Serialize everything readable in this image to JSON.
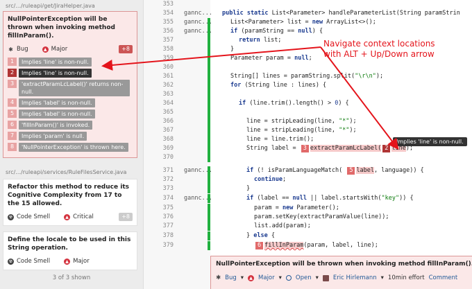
{
  "issues": [
    {
      "file": "src/.../ruleapi/get/JiraHelper.java",
      "title": "NullPointerException will be thrown when invoking method fillInParam().",
      "type": "Bug",
      "severity": "Major",
      "count": "+8",
      "locations": [
        {
          "n": "1",
          "text": "Implies 'line' is non-null."
        },
        {
          "n": "2",
          "text": "Implies 'line' is non-null."
        },
        {
          "n": "3",
          "text": "'extractParamLcLabel()' returns non-null."
        },
        {
          "n": "4",
          "text": "Implies 'label' is non-null."
        },
        {
          "n": "5",
          "text": "Implies 'label' is non-null."
        },
        {
          "n": "6",
          "text": "'fillInParam()' is invoked."
        },
        {
          "n": "7",
          "text": "Implies 'param' is null."
        },
        {
          "n": "8",
          "text": "'NullPointerException' is thrown here."
        }
      ]
    },
    {
      "file": "src/.../ruleapi/services/RuleFilesService.java",
      "title": "Refactor this method to reduce its Cognitive Complexity from 17 to the 15 allowed.",
      "type": "Code Smell",
      "severity": "Critical",
      "count": "+8"
    },
    {
      "title": "Define the locale to be used in this String operation.",
      "type": "Code Smell",
      "severity": "Major"
    }
  ],
  "shown_label": "3 of 3 shown",
  "code": {
    "lines": [
      {
        "ln": "353",
        "author": ""
      },
      {
        "ln": "354",
        "author": "gannc..."
      },
      {
        "ln": "355",
        "author": "gannc..."
      },
      {
        "ln": "356",
        "author": "gannc..."
      },
      {
        "ln": "357",
        "author": ""
      },
      {
        "ln": "358",
        "author": ""
      },
      {
        "ln": "359",
        "author": ""
      },
      {
        "ln": "360",
        "author": ""
      },
      {
        "ln": "361",
        "author": ""
      },
      {
        "ln": "362",
        "author": ""
      },
      {
        "ln": "363",
        "author": ""
      },
      {
        "ln": "364",
        "author": ""
      },
      {
        "ln": "365",
        "author": ""
      },
      {
        "ln": "366",
        "author": ""
      },
      {
        "ln": "367",
        "author": ""
      },
      {
        "ln": "368",
        "author": ""
      },
      {
        "ln": "369",
        "author": ""
      },
      {
        "ln": "370",
        "author": ""
      },
      {
        "ln": "371",
        "author": "gannc..."
      },
      {
        "ln": "372",
        "author": ""
      },
      {
        "ln": "373",
        "author": ""
      },
      {
        "ln": "374",
        "author": "gannc..."
      },
      {
        "ln": "375",
        "author": ""
      },
      {
        "ln": "376",
        "author": ""
      },
      {
        "ln": "377",
        "author": ""
      },
      {
        "ln": "378",
        "author": ""
      },
      {
        "ln": "379",
        "author": ""
      }
    ],
    "src": {
      "l354a": "public static ",
      "l354b": "List<Parameter> handleParameterList(String paramStrin",
      "l355": "List<Parameter> list = ",
      "l355kw": "new",
      "l355b": " ArrayList<>();",
      "l356kw": "if",
      "l356a": " (paramString == ",
      "l356kw2": "null",
      "l356b": ") {",
      "l357kw": "return",
      "l357a": " list;",
      "l358": "}",
      "l359a": "Parameter param = ",
      "l359kw": "null",
      "l359b": ";",
      "l361a": "String[] lines = paramString.split(",
      "l361s": "\"\\r\\n\"",
      "l361b": ");",
      "l362kw": "for",
      "l362a": " (String line : lines) {",
      "l364kw": "if",
      "l364a": " (line.trim().length() > ",
      "l364n": "0",
      "l364b": ") {",
      "l366a": "line = stripLeading(line, ",
      "l366s": "\"*\"",
      "l366b": ");",
      "l367a": "line = stripLeading(line, ",
      "l367s": "\"*\"",
      "l367b": ");",
      "l368a": "line = line.trim();",
      "l369a": "String label = ",
      "l369n3": "3",
      "l369b": "extractParamLcLabel(",
      "l369n2": "2",
      "l369c": "line",
      "l369d": ");",
      "l371kw": "if",
      "l371a": " (! isParamLanguageMatch( ",
      "l371n5": "5",
      "l371b": "label",
      "l371c": ", language)) {",
      "l372kw": "continue",
      "l372a": ";",
      "l373": "}",
      "l374kw": "if",
      "l374a": " (label == ",
      "l374kw2": "null",
      "l374b": " || label.startsWith(",
      "l374s": "\"key\"",
      "l374c": ")) {",
      "l375a": "param = ",
      "l375kw": "new",
      "l375b": " Parameter();",
      "l376a": "param.setKey(extractParamValue(line));",
      "l377a": "list.add(param);",
      "l378a": "} ",
      "l378kw": "else",
      "l378b": " {",
      "l379n6": "6",
      "l379a": "fillInParam",
      "l379b": "(param, label, line);"
    }
  },
  "tooltip": "Implies 'line' is non-null.",
  "annotation": [
    "Navigate context locations",
    "with ALT + Up/Down arrow"
  ],
  "issue_box": {
    "title": "NullPointerException will be thrown when invoking method fillInParam().",
    "more": "...",
    "type": "Bug",
    "severity": "Major",
    "status": "Open",
    "assignee": "Eric Hirlemann",
    "effort": "10min effort",
    "comment": "Comment"
  },
  "colors": {
    "accent_red": "#e4141b",
    "coverage_green": "#21b13f",
    "issue_bg": "#fbe8e8"
  }
}
